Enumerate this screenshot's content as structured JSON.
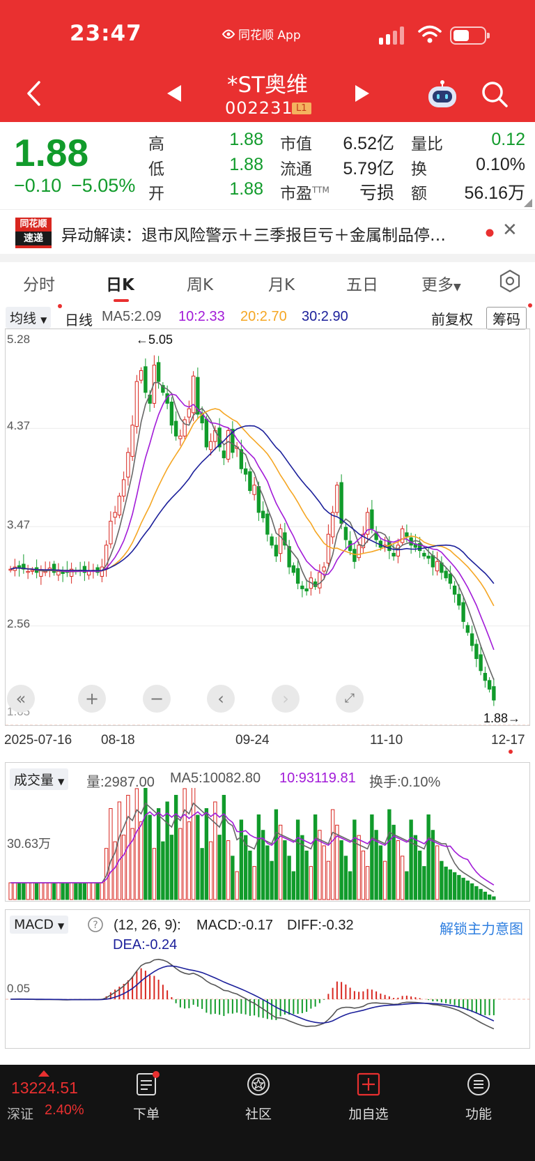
{
  "status": {
    "time": "23:47",
    "app_name": "同花顺 App"
  },
  "header": {
    "stock_name": "*ST奥维",
    "stock_code": "002231",
    "level_badge": "L1"
  },
  "quote": {
    "price": "1.88",
    "change": "−0.10",
    "change_pct": "−5.05%",
    "high_label": "高",
    "high": "1.88",
    "low_label": "低",
    "low": "1.88",
    "open_label": "开",
    "open": "1.88",
    "mktcap_label": "市值",
    "mktcap": "6.52亿",
    "float_label": "流通",
    "float": "5.79亿",
    "pe_label": "市盈",
    "pe_sup": "TTM",
    "pe": "亏损",
    "vol_ratio_label": "量比",
    "vol_ratio": "0.12",
    "turnover_label": "换",
    "turnover": "0.10%",
    "amount_label": "额",
    "amount": "56.16万"
  },
  "news": {
    "logo_top": "同花顺",
    "logo_bottom": "速递",
    "text": "异动解读：退市风险警示＋三季报巨亏＋金属制品停…"
  },
  "tabs": [
    "分时",
    "日K",
    "周K",
    "月K",
    "五日",
    "更多"
  ],
  "active_tab": 1,
  "kline": {
    "ma_selector": "均线",
    "period": "日线",
    "ma5": "MA5:2.09",
    "ma10": "10:2.33",
    "ma20": "20:2.70",
    "ma30": "30:2.90",
    "adjust": "前复权",
    "chips": "筹码",
    "y_ticks": [
      "5.28",
      "4.37",
      "3.47",
      "2.56",
      "1.65"
    ],
    "max_marker": "←5.05",
    "min_marker": "1.88→",
    "dates": [
      "2025-07-16",
      "08-18",
      "09-24",
      "11-10",
      "12-17"
    ]
  },
  "volume": {
    "selector": "成交量",
    "vol": "量:2987.00",
    "ma5": "MA5:10082.80",
    "ma10": "10:93119.81",
    "turnover": "换手:0.10%",
    "y_tick": "30.63万"
  },
  "macd": {
    "selector": "MACD",
    "params": "(12, 26, 9):",
    "macd": "MACD:-0.17",
    "diff": "DIFF:-0.32",
    "dea": "DEA:-0.24",
    "unlock": "解锁主力意图",
    "y_tick": "0.05"
  },
  "bottom": {
    "index_value": "13224.51",
    "market": "深证",
    "index_pct": "2.40%",
    "items": [
      "下单",
      "社区",
      "加自选",
      "功能"
    ]
  },
  "colors": {
    "up": "#d8261f",
    "down": "#119b2b",
    "ma5": "#666666",
    "ma10": "#a21bd8",
    "ma20": "#f5a623",
    "ma30": "#1b1f9a",
    "brand": "#e93030"
  },
  "chart_data": {
    "type": "candlestick",
    "x_range": [
      "2025-07-16",
      "2025-12-17"
    ],
    "y_range": [
      1.65,
      5.28
    ],
    "close": [
      3.08,
      3.1,
      3.09,
      3.08,
      3.06,
      3.07,
      3.05,
      3.07,
      3.06,
      3.09,
      3.05,
      3.06,
      3.04,
      3.05,
      3.08,
      3.06,
      3.07,
      3.05,
      3.06,
      3.07,
      3.05,
      3.1,
      3.3,
      3.52,
      3.6,
      3.75,
      3.9,
      4.15,
      4.4,
      4.8,
      4.9,
      4.7,
      4.6,
      4.95,
      4.8,
      4.7,
      4.6,
      4.4,
      4.3,
      4.3,
      4.45,
      4.55,
      4.85,
      4.5,
      4.42,
      4.2,
      4.25,
      4.35,
      4.2,
      4.1,
      4.35,
      4.15,
      4.2,
      4.0,
      3.95,
      3.8,
      3.85,
      3.6,
      3.55,
      3.4,
      3.3,
      3.2,
      3.45,
      3.3,
      3.1,
      3.05,
      2.95,
      2.9,
      2.88,
      3.0,
      2.92,
      3.05,
      3.1,
      3.4,
      3.6,
      3.85,
      3.5,
      3.35,
      3.25,
      3.15,
      3.3,
      3.4,
      3.6,
      3.45,
      3.35,
      3.28,
      3.3,
      3.25,
      3.2,
      3.3,
      3.45,
      3.38,
      3.3,
      3.28,
      3.25,
      3.2,
      3.18,
      3.1,
      3.15,
      3.05,
      3.0,
      2.95,
      2.85,
      2.75,
      2.6,
      2.5,
      2.38,
      2.26,
      2.15,
      2.06,
      1.98,
      1.88
    ],
    "ma5_last": 2.09,
    "ma10_last": 2.33,
    "ma20_last": 2.7,
    "ma30_last": 2.9
  }
}
